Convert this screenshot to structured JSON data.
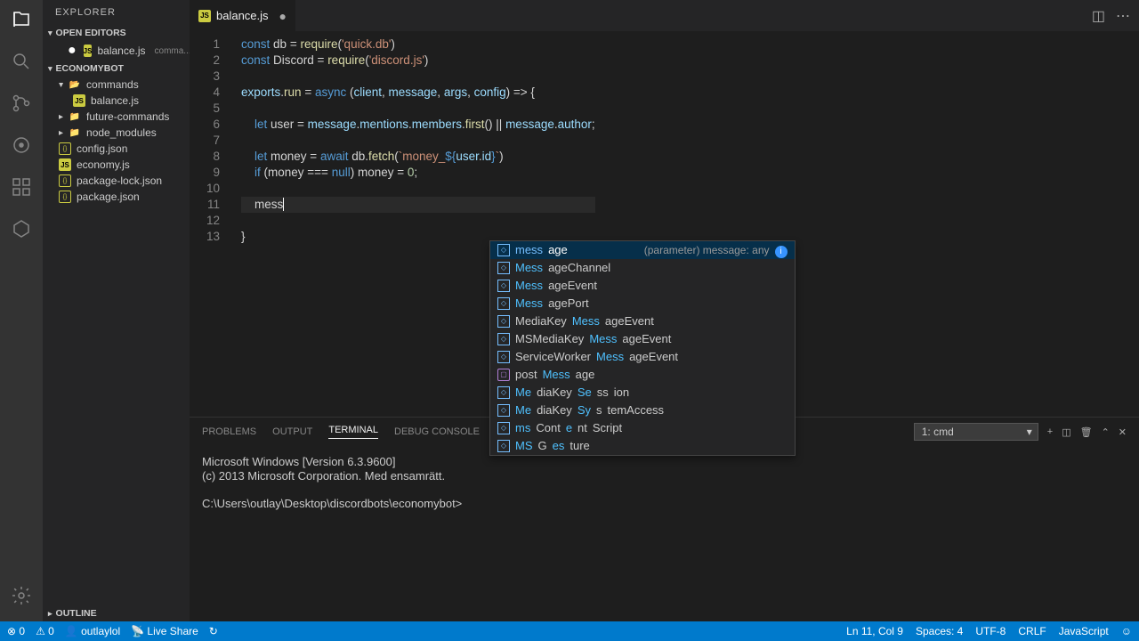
{
  "sidebar": {
    "title": "EXPLORER",
    "openEditors": "OPEN EDITORS",
    "project": "ECONOMYBOT",
    "outline": "OUTLINE",
    "open_file": {
      "name": "balance.js",
      "hint": "comma..."
    },
    "tree": [
      {
        "type": "folder-open",
        "name": "commands",
        "indent": 0
      },
      {
        "type": "js",
        "name": "balance.js",
        "indent": 1
      },
      {
        "type": "folder",
        "name": "future-commands",
        "indent": 0
      },
      {
        "type": "folder",
        "name": "node_modules",
        "indent": 0
      },
      {
        "type": "json",
        "name": "config.json",
        "indent": 0
      },
      {
        "type": "js",
        "name": "economy.js",
        "indent": 0
      },
      {
        "type": "json",
        "name": "package-lock.json",
        "indent": 0
      },
      {
        "type": "json",
        "name": "package.json",
        "indent": 0
      }
    ]
  },
  "tab": {
    "icon": "js",
    "name": "balance.js"
  },
  "code": {
    "lines": [
      "1",
      "2",
      "3",
      "4",
      "5",
      "6",
      "7",
      "8",
      "9",
      "10",
      "11",
      "12",
      "13"
    ],
    "l1a": "const",
    "l1b": " db ",
    "l1c": "= ",
    "l1d": "require",
    "l1e": "(",
    "l1f": "'quick.db'",
    "l1g": ")",
    "l2a": "const",
    "l2b": " Discord ",
    "l2c": "= ",
    "l2d": "require",
    "l2e": "(",
    "l2f": "'discord.js'",
    "l2g": ")",
    "l4a": "exports",
    "l4b": ".",
    "l4c": "run",
    "l4d": " = ",
    "l4e": "async",
    "l4f": " (",
    "l4g": "client",
    "l4h": ", ",
    "l4i": "message",
    "l4j": ", ",
    "l4k": "args",
    "l4l": ", ",
    "l4m": "config",
    "l4n": ") => {",
    "l6a": "    let",
    "l6b": " user ",
    "l6c": "= ",
    "l6d": "message",
    "l6e": ".",
    "l6f": "mentions",
    "l6g": ".",
    "l6h": "members",
    "l6i": ".",
    "l6j": "first",
    "l6k": "() || ",
    "l6l": "message",
    "l6m": ".",
    "l6n": "author",
    "l6o": ";",
    "l8a": "    let",
    "l8b": " money ",
    "l8c": "= ",
    "l8d": "await",
    "l8e": " db.",
    "l8f": "fetch",
    "l8g": "(",
    "l8h": "`money_",
    "l8i": "${",
    "l8j": "user",
    "l8k": ".",
    "l8l": "id",
    "l8m": "}",
    "l8n": "`",
    "l8o": ")",
    "l9a": "    if",
    "l9b": " (money === ",
    "l9c": "null",
    "l9d": ") money = ",
    "l9e": "0",
    "l9f": ";",
    "l11": "    mess",
    "l13": "}"
  },
  "autocomplete": {
    "detail": "(parameter) message: any",
    "items": [
      {
        "hi": "mess",
        "rest": "age",
        "icon": "var"
      },
      {
        "hi": "Mess",
        "rest": "ageChannel",
        "icon": "var"
      },
      {
        "hi": "Mess",
        "rest": "ageEvent",
        "icon": "var"
      },
      {
        "hi": "Mess",
        "rest": "agePort",
        "icon": "var"
      },
      {
        "pre": "MediaKey",
        "hi": "Mess",
        "rest": "ageEvent",
        "icon": "var"
      },
      {
        "pre": "MSMediaKey",
        "hi": "Mess",
        "rest": "ageEvent",
        "icon": "var"
      },
      {
        "pre": "ServiceWorker",
        "hi": "Mess",
        "rest": "ageEvent",
        "icon": "var"
      },
      {
        "pre": "post",
        "hi": "Mess",
        "rest": "age",
        "icon": "fn"
      },
      {
        "hi": "Me",
        "mid": "diaKey",
        "hi2": "Se",
        "mid2": "ss",
        "rest": "ion",
        "icon": "var"
      },
      {
        "hi": "Me",
        "mid": "diaKey",
        "hi2": "Sy",
        "mid2": "s",
        "rest": "temAccess",
        "icon": "var"
      },
      {
        "hi": "ms",
        "mid": "Cont",
        "hi2": "e",
        "mid2": "nt",
        "rest": "Script",
        "icon": "var"
      },
      {
        "hi": "MS",
        "mid": "G",
        "hi2": "es",
        "rest": "ture",
        "icon": "var"
      }
    ]
  },
  "panel": {
    "tabs": [
      "PROBLEMS",
      "OUTPUT",
      "TERMINAL",
      "DEBUG CONSOLE"
    ],
    "active": 2,
    "terminal_select": "1: cmd",
    "line1": "Microsoft Windows [Version 6.3.9600]",
    "line2": "(c) 2013 Microsoft Corporation. Med ensamrätt.",
    "prompt": "C:\\Users\\outlay\\Desktop\\discordbots\\economybot>"
  },
  "status": {
    "errors": "⊗ 0",
    "warnings": "⚠ 0",
    "user": "outlaylol",
    "live": "Live Share",
    "sync": "↻",
    "pos": "Ln 11, Col 9",
    "spaces": "Spaces: 4",
    "enc": "UTF-8",
    "eol": "CRLF",
    "lang": "JavaScript",
    "smile": "☺"
  }
}
